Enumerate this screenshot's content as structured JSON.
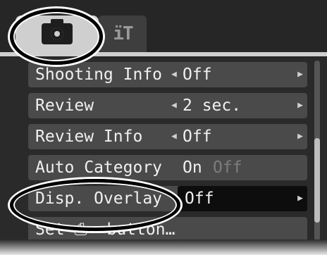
{
  "tabs": {
    "shooting_icon": "camera-icon",
    "setup_glyph": "ïT",
    "setup_icon": "setup-tools-icon"
  },
  "menu": {
    "rows": [
      {
        "label": "Shooting Info",
        "value": "Off"
      },
      {
        "label": "Review",
        "value": "2 sec."
      },
      {
        "label": "Review Info",
        "value": "Off"
      },
      {
        "label": "Auto Category",
        "option_on": "On",
        "option_off": "Off"
      },
      {
        "label": "Disp. Overlay",
        "value": "Off"
      },
      {
        "label": "Set ⎙⌁ button…"
      }
    ],
    "arrow_left": "◀",
    "arrow_right": "▶"
  },
  "colors": {
    "screen_bg": "#2a2a2a",
    "row_bg": "#4a4a4a",
    "selected_bg": "#0d0d0d",
    "active_tab": "#cfcfcf"
  }
}
